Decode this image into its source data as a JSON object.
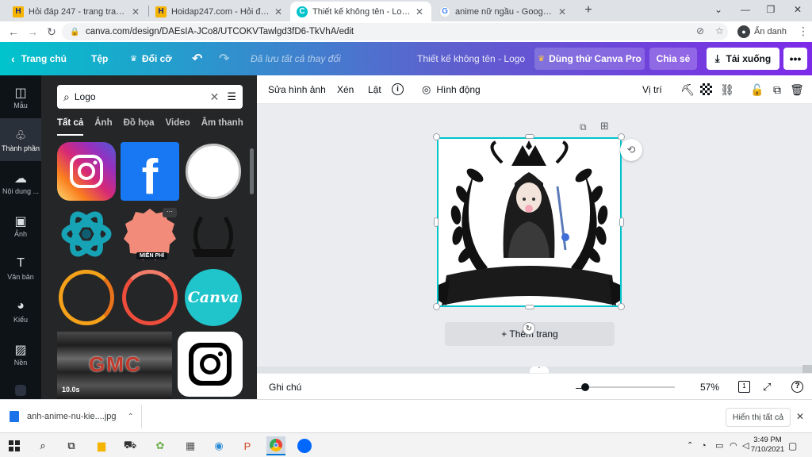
{
  "browser": {
    "tabs": [
      {
        "title": "Hỏi đáp 247 - trang tra loi",
        "favicon": "hoidap-h-icon",
        "active": false
      },
      {
        "title": "Hoidap247.com - Hỏi đáp online",
        "favicon": "hoidap-h-icon",
        "active": false
      },
      {
        "title": "Thiết kế không tên - Logo",
        "favicon": "canva-c-icon",
        "active": true
      },
      {
        "title": "anime nữ ngầu - Google Tìm kiế",
        "favicon": "google-g-icon",
        "active": false
      }
    ],
    "url": "canva.com/design/DAEsIA-JCo8/UTCOKVTawlgd3fD6-TkVhA/edit",
    "profile_label": "Ẩn danh"
  },
  "topbar": {
    "home": "Trang chủ",
    "file": "Tệp",
    "resize": "Đổi cỡ",
    "saved_status": "Đã lưu tất cả thay đổi",
    "design_title": "Thiết kế không tên - Logo",
    "try_pro": "Dùng thử Canva Pro",
    "share": "Chia sẻ",
    "download": "Tải xuống"
  },
  "rail": [
    {
      "label": "Mẫu",
      "icon": "template-icon"
    },
    {
      "label": "Thành phần",
      "icon": "elements-icon",
      "active": true
    },
    {
      "label": "Nội dung ...",
      "icon": "upload-icon"
    },
    {
      "label": "Ảnh",
      "icon": "photo-icon"
    },
    {
      "label": "Văn bản",
      "icon": "text-icon"
    },
    {
      "label": "Kiểu",
      "icon": "palette-icon"
    },
    {
      "label": "Nền",
      "icon": "background-icon"
    }
  ],
  "panel": {
    "search_value": "Logo",
    "tabs": [
      "Tất cả",
      "Ảnh",
      "Đồ họa",
      "Video",
      "Âm thanh"
    ],
    "free_badge": "MIỄN PHÍ",
    "gmc_text": "GMC",
    "video_duration": "10.0s",
    "canva_text": "Canva",
    "facebook_glyph": "f"
  },
  "editor_toolbar": {
    "edit_image": "Sửa hình ảnh",
    "crop": "Xén",
    "flip": "Lật",
    "animate": "Hình động",
    "position": "Vị trí"
  },
  "canvas": {
    "add_page": "+ Thêm trang"
  },
  "bottombar": {
    "notes": "Ghi chú",
    "zoom": "57%",
    "zoom_level": 0.57,
    "page_count": "1",
    "help": "?"
  },
  "downloads": {
    "file_name": "anh-anime-nu-kie....jpg",
    "show_all": "Hiển thị tất cả"
  },
  "taskbar": {
    "time": "3:49 PM",
    "date": "7/10/2021"
  },
  "colors": {
    "accent_teal": "#00c4cc",
    "accent_purple": "#7d2ae8",
    "rail_bg": "#0e1318",
    "panel_bg": "#252627"
  }
}
